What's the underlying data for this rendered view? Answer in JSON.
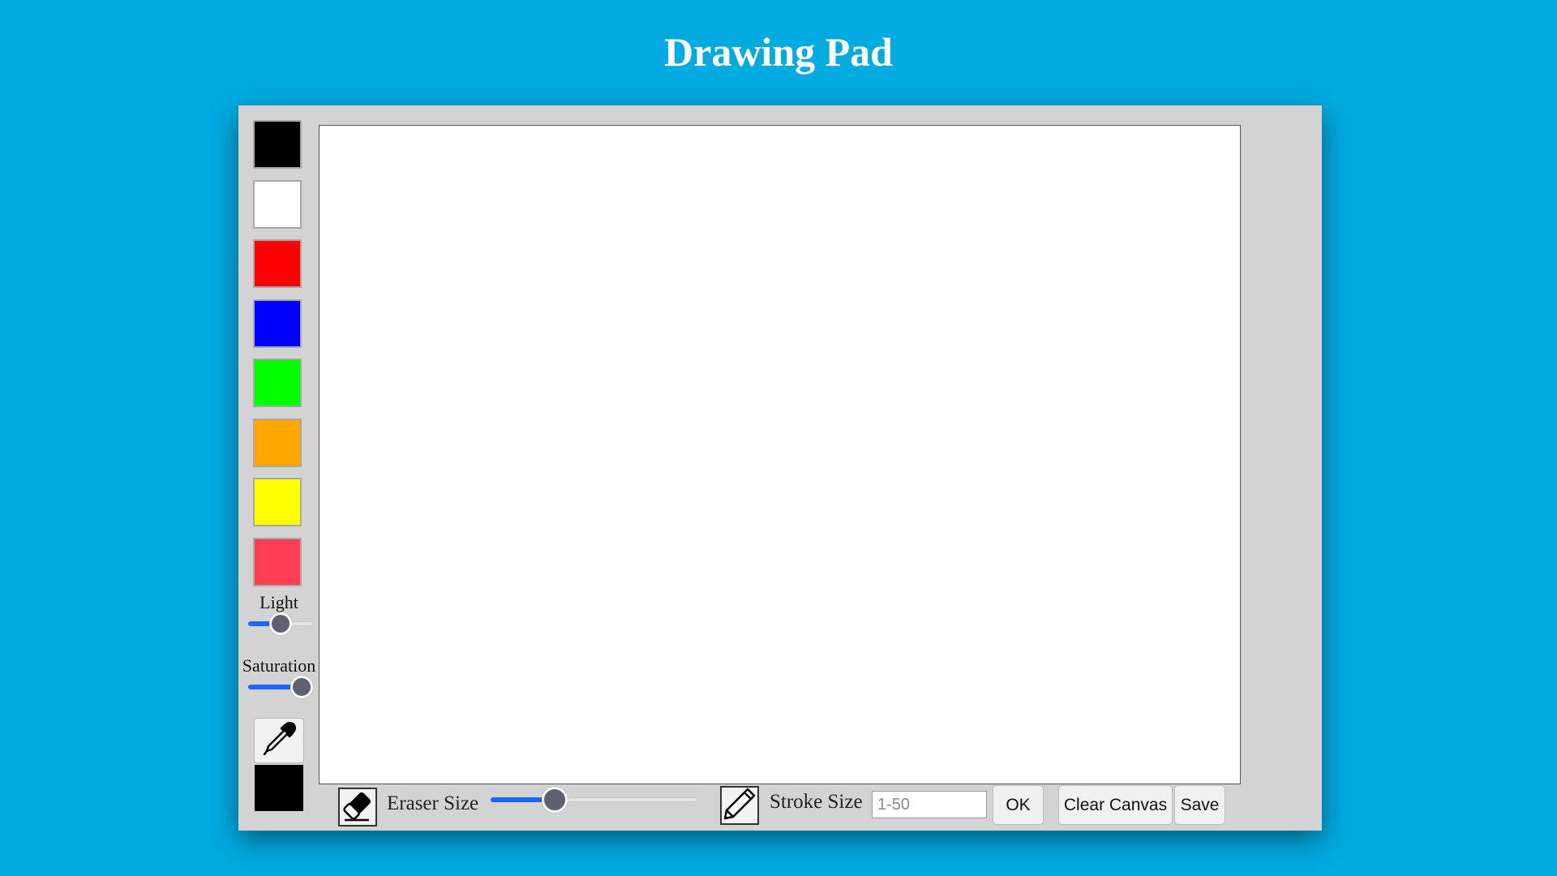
{
  "page": {
    "title": "Drawing Pad"
  },
  "palette": {
    "swatches": [
      {
        "name": "black",
        "color": "#000000"
      },
      {
        "name": "white",
        "color": "#ffffff"
      },
      {
        "name": "red",
        "color": "#ff0000"
      },
      {
        "name": "blue",
        "color": "#0000ff"
      },
      {
        "name": "green",
        "color": "#00ff00"
      },
      {
        "name": "orange",
        "color": "#ffa500"
      },
      {
        "name": "yellow",
        "color": "#ffff00"
      },
      {
        "name": "crimson",
        "color": "#ff3d55"
      }
    ],
    "light_label": "Light",
    "light_value": 0.5,
    "saturation_label": "Saturation",
    "saturation_value": 1.0,
    "eyedropper_icon": "eyedropper-icon",
    "current_color": "#000000"
  },
  "toolbar": {
    "eraser_icon": "eraser-icon",
    "eraser_size_label": "Eraser Size",
    "eraser_size_value": 0.28,
    "pencil_icon": "pencil-icon",
    "stroke_size_label": "Stroke Size",
    "stroke_input_placeholder": "1-50",
    "stroke_input_value": "",
    "ok_label": "OK",
    "clear_label": "Clear Canvas",
    "save_label": "Save"
  },
  "colors": {
    "background": "#00abe1",
    "pad": "#d3d3d3",
    "slider_fill": "#1a66ff"
  }
}
